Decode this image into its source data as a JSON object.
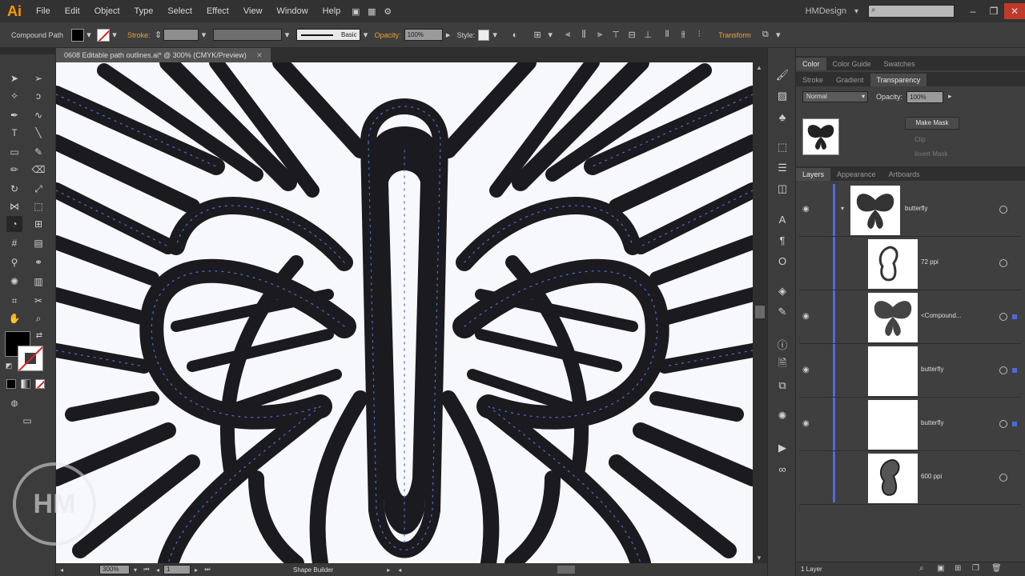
{
  "app": {
    "logo": "Ai",
    "workspace": "HMDesign"
  },
  "menu": [
    "File",
    "Edit",
    "Object",
    "Type",
    "Select",
    "Effect",
    "View",
    "Window",
    "Help"
  ],
  "controlbar": {
    "selection_type": "Compound Path",
    "stroke_label": "Stroke:",
    "brush_label": "Basic",
    "opacity_label": "Opacity:",
    "opacity_value": "100%",
    "style_label": "Style:",
    "transform_label": "Transform"
  },
  "document": {
    "tab_title": "0608 Editable path outlines.ai* @ 300% (CMYK/Preview)"
  },
  "statusbar": {
    "zoom": "300%",
    "page": "1",
    "tool": "Shape Builder"
  },
  "panels": {
    "top_tabs": [
      "Color",
      "Color Guide",
      "Swatches"
    ],
    "mid_tabs": [
      "Stroke",
      "Gradient",
      "Transparency"
    ],
    "blend_mode": "Normal",
    "opacity_label": "Opacity:",
    "opacity_value": "100%",
    "make_mask": "Make Mask",
    "clip": "Clip",
    "invert_mask": "Invert Mask",
    "layer_tabs": [
      "Layers",
      "Appearance",
      "Artboards"
    ],
    "layers": [
      {
        "name": "butterfly"
      },
      {
        "name": "72 ppi"
      },
      {
        "name": "<Compound..."
      },
      {
        "name": "butterfly"
      },
      {
        "name": "butterfly"
      },
      {
        "name": "600 ppi"
      }
    ],
    "layer_count": "1 Layer"
  },
  "watermark": "HM",
  "colors": {
    "accent": "#e9a23b",
    "path_blue": "#4f6ad8",
    "artwork": "#1b1b1f"
  }
}
